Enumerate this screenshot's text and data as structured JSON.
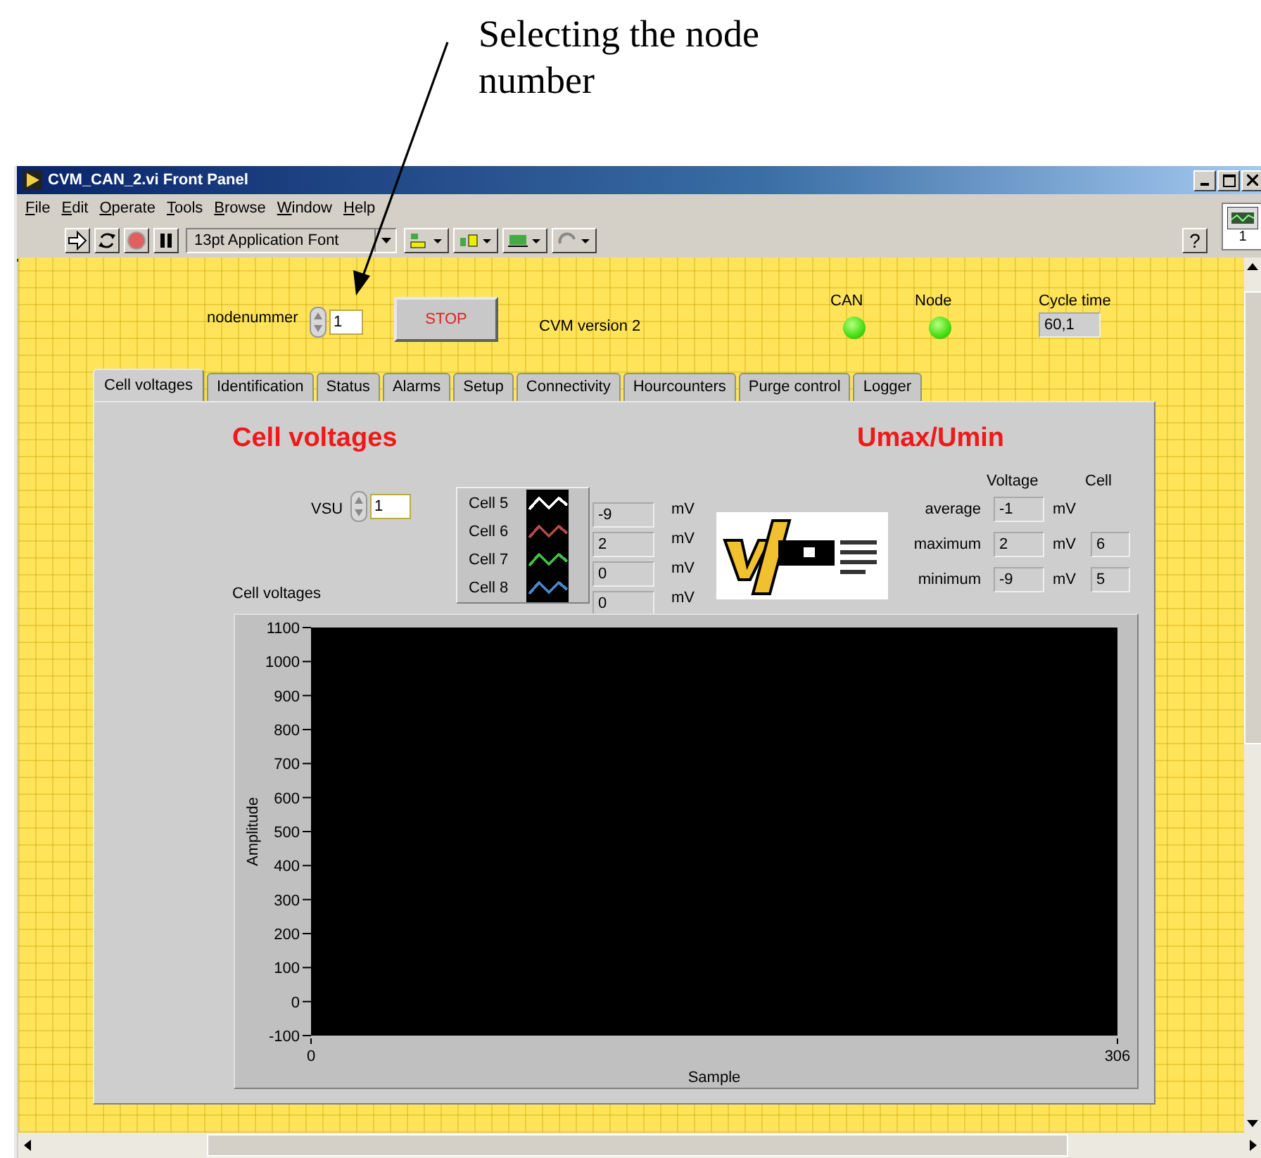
{
  "annotation": {
    "text": "Selecting the node number"
  },
  "window": {
    "title": "CVM_CAN_2.vi Front Panel"
  },
  "menu": [
    {
      "label": "File"
    },
    {
      "label": "Edit"
    },
    {
      "label": "Operate"
    },
    {
      "label": "Tools"
    },
    {
      "label": "Browse"
    },
    {
      "label": "Window"
    },
    {
      "label": "Help"
    }
  ],
  "toolbar": {
    "font": "13pt Application Font",
    "help": "?",
    "connector_pane": "1"
  },
  "controls": {
    "nodenummer": {
      "label": "nodenummer",
      "value": "1"
    },
    "stop": {
      "label": "STOP"
    },
    "version": "CVM version 2",
    "indicators": [
      {
        "label": "CAN",
        "on": true
      },
      {
        "label": "Node",
        "on": true
      }
    ],
    "cycle_time": {
      "label": "Cycle time",
      "value": "60,1"
    }
  },
  "tabs": [
    {
      "label": "Cell voltages",
      "selected": true
    },
    {
      "label": "Identification",
      "selected": false
    },
    {
      "label": "Status",
      "selected": false
    },
    {
      "label": "Alarms",
      "selected": false
    },
    {
      "label": "Setup",
      "selected": false
    },
    {
      "label": "Connectivity",
      "selected": false
    },
    {
      "label": "Hourcounters",
      "selected": false
    },
    {
      "label": "Purge control",
      "selected": false
    },
    {
      "label": "Logger",
      "selected": false
    }
  ],
  "cell_voltages": {
    "title": "Cell voltages",
    "vsu": {
      "label": "VSU",
      "value": "1"
    },
    "cells": [
      {
        "name": "Cell 5",
        "color": "#ffffff",
        "value": "-9",
        "unit": "mV"
      },
      {
        "name": "Cell 6",
        "color": "#b04848",
        "value": "2",
        "unit": "mV"
      },
      {
        "name": "Cell 7",
        "color": "#40c040",
        "value": "0",
        "unit": "mV"
      },
      {
        "name": "Cell 8",
        "color": "#4a86c8",
        "value": "0",
        "unit": "mV"
      }
    ],
    "graph": {
      "label": "Cell voltages",
      "chart_data": {
        "type": "line",
        "xlabel": "Sample",
        "ylabel": "Amplitude",
        "xlim": [
          0,
          306
        ],
        "ylim": [
          -100,
          1100
        ],
        "xticks": [
          0,
          306
        ],
        "yticks": [
          -100,
          0,
          100,
          200,
          300,
          400,
          500,
          600,
          700,
          800,
          900,
          1000,
          1100
        ]
      }
    }
  },
  "umax_umin": {
    "title": "Umax/Umin",
    "headers": [
      "Voltage",
      "Cell"
    ],
    "rows": [
      {
        "label": "average",
        "voltage": "-1",
        "unit": "mV"
      },
      {
        "label": "maximum",
        "voltage": "2",
        "unit": "mV",
        "cell": "6"
      },
      {
        "label": "minimum",
        "voltage": "-9",
        "unit": "mV",
        "cell": "5"
      }
    ]
  }
}
